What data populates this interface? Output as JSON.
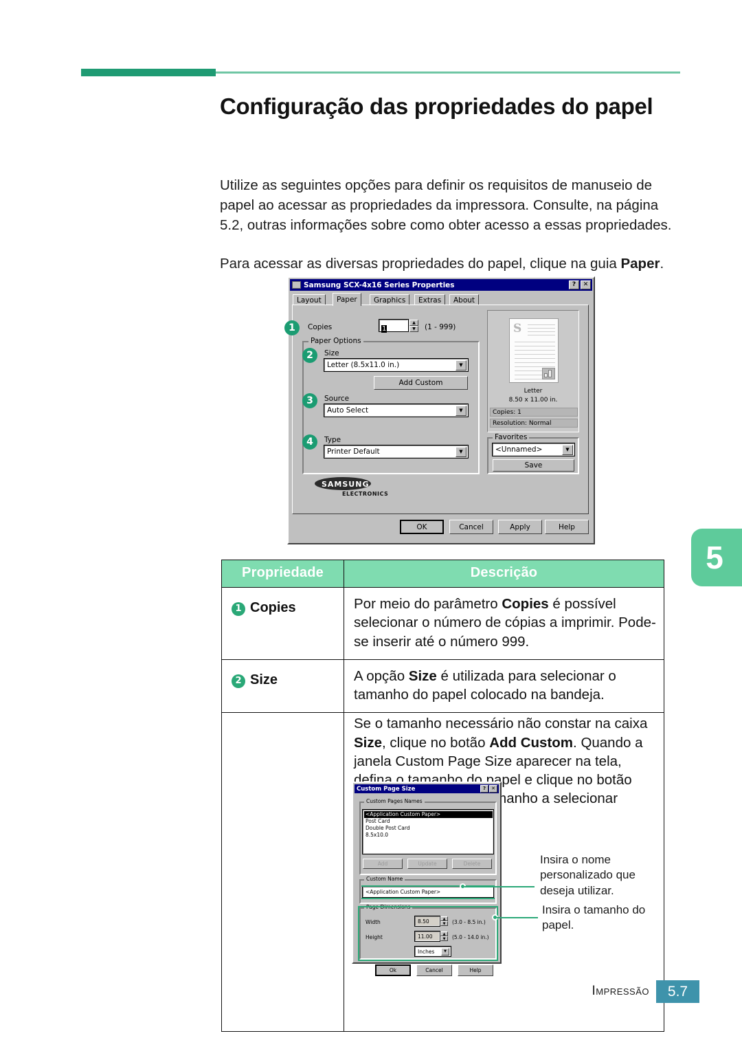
{
  "page": {
    "title": "Configuração das propriedades do papel",
    "paragraph1": "Utilize as seguintes opções para definir os requisitos de manuseio de papel ao acessar as propriedades da impressora. Consulte, na página 5.2, outras informações sobre como obter acesso a essas propriedades.",
    "paragraph2_pre": "Para acessar as diversas propriedades do papel, clique na guia ",
    "paragraph2_bold": "Paper",
    "paragraph2_post": ".",
    "chapter_tab": "5",
    "footer_label": "Impressão",
    "footer_page": "5.7",
    "accent_green": "#2aa877",
    "header_green": "#7fdcb0",
    "rule_green": "#1f9b73",
    "tab_green": "#5ecb9b",
    "footer_blue": "#3e93ab"
  },
  "printer_dialog": {
    "title": "Samsung SCX-4x16 Series Properties",
    "help_button": "?",
    "close_button": "✕",
    "tabs": [
      {
        "label": "Layout",
        "active": false
      },
      {
        "label": "Paper",
        "active": true
      },
      {
        "label": "Graphics",
        "active": false
      },
      {
        "label": "Extras",
        "active": false
      },
      {
        "label": "About",
        "active": false
      }
    ],
    "copies": {
      "badge": "1",
      "label": "Copies",
      "value": "1",
      "range": "(1 - 999)"
    },
    "paper_options": {
      "group_label": "Paper Options",
      "size": {
        "badge": "2",
        "label": "Size",
        "value": "Letter (8.5x11.0 in.)"
      },
      "add_custom_button": "Add Custom",
      "source": {
        "badge": "3",
        "label": "Source",
        "value": "Auto Select"
      },
      "type": {
        "badge": "4",
        "label": "Type",
        "value": "Printer Default"
      }
    },
    "preview": {
      "page_letter": "S",
      "size_name": "Letter",
      "size_dims": "8.50 x 11.00 in.",
      "copies_info": "Copies: 1",
      "resolution_info": "Resolution: Normal"
    },
    "favorites": {
      "group_label": "Favorites",
      "value": "<Unnamed>",
      "save_button": "Save"
    },
    "brand": "SAMSUNG",
    "brand_sub": "ELECTRONICS",
    "buttons": [
      "OK",
      "Cancel",
      "Apply",
      "Help"
    ]
  },
  "table": {
    "headers": [
      "Propriedade",
      "Descrição"
    ],
    "rows": [
      {
        "badge": "1",
        "property": "Copies",
        "description_html": "Por meio do parâmetro <b>Copies</b> é possível selecionar o número de cópias a imprimir. Pode-se inserir até o número 999."
      },
      {
        "badge": "2",
        "property": "Size",
        "description_html": "A opção <b>Size</b> é utilizada para selecionar o tamanho do papel colocado na bandeja."
      },
      {
        "badge": "",
        "property": "",
        "description_html": "Se o tamanho necessário não constar na caixa <b>Size</b>, clique no botão <b>Add Custom</b>. Quando a janela Custom Page Size aparecer na tela, defina o tamanho do papel e clique no botão <b>Ok</b>. O parâmetro do tamanho a selecionar aparece na lista Size."
      }
    ]
  },
  "custom_page_dialog": {
    "title": "Custom Page Size",
    "help_button": "?",
    "close_button": "✕",
    "names_group_label": "Custom Pages Names",
    "names_list": [
      "<Application Custom Paper>",
      "Post Card",
      "Double Post Card",
      "8.5x10.0"
    ],
    "list_buttons": [
      "Add",
      "Update",
      "Delete"
    ],
    "custom_name_group_label": "Custom Name",
    "custom_name_value": "<Application Custom Paper>",
    "page_dimensions_group_label": "Page Dimensions",
    "width_label": "Width",
    "width_value": "8.50",
    "width_range": "(3.0 - 8.5 in.)",
    "height_label": "Height",
    "height_value": "11.00",
    "height_range": "(5.0 - 14.0 in.)",
    "units_value": "Inches",
    "buttons": [
      "Ok",
      "Cancel",
      "Help"
    ],
    "annotation_name": "Insira o nome personalizado que deseja utilizar.",
    "annotation_size": "Insira o tamanho do papel."
  }
}
